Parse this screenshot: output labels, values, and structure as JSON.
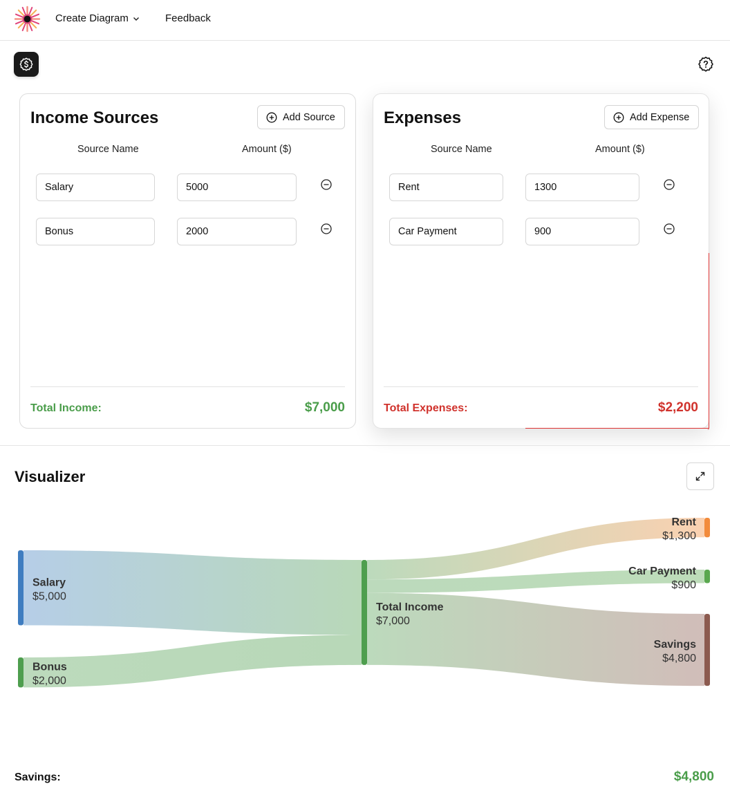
{
  "nav": {
    "create_label": "Create Diagram",
    "feedback_label": "Feedback"
  },
  "income": {
    "title": "Income Sources",
    "add_label": "Add Source",
    "col_name": "Source Name",
    "col_amount": "Amount ($)",
    "rows": [
      {
        "name": "Salary",
        "amount": "5000"
      },
      {
        "name": "Bonus",
        "amount": "2000"
      }
    ],
    "total_label": "Total Income:",
    "total_value": "$7,000"
  },
  "expenses": {
    "title": "Expenses",
    "add_label": "Add Expense",
    "col_name": "Source Name",
    "col_amount": "Amount ($)",
    "rows": [
      {
        "name": "Rent",
        "amount": "1300"
      },
      {
        "name": "Car Payment",
        "amount": "900"
      }
    ],
    "total_label": "Total Expenses:",
    "total_value": "$2,200"
  },
  "visualizer": {
    "title": "Visualizer"
  },
  "chart_data": {
    "type": "sankey",
    "nodes": [
      {
        "id": "salary",
        "name": "Salary",
        "value_label": "$5,000",
        "value": 5000,
        "color": "#3f7dc0"
      },
      {
        "id": "bonus",
        "name": "Bonus",
        "value_label": "$2,000",
        "value": 2000,
        "color": "#4e9e4e"
      },
      {
        "id": "total",
        "name": "Total Income",
        "value_label": "$7,000",
        "value": 7000,
        "color": "#4e9e4e"
      },
      {
        "id": "rent",
        "name": "Rent",
        "value_label": "$1,300",
        "value": 1300,
        "color": "#f28b3c"
      },
      {
        "id": "car",
        "name": "Car Payment",
        "value_label": "$900",
        "value": 900,
        "color": "#5aa84f"
      },
      {
        "id": "savings",
        "name": "Savings",
        "value_label": "$4,800",
        "value": 4800,
        "color": "#8c5a4f"
      }
    ],
    "links": [
      {
        "source": "salary",
        "target": "total",
        "value": 5000
      },
      {
        "source": "bonus",
        "target": "total",
        "value": 2000
      },
      {
        "source": "total",
        "target": "rent",
        "value": 1300
      },
      {
        "source": "total",
        "target": "car",
        "value": 900
      },
      {
        "source": "total",
        "target": "savings",
        "value": 4800
      }
    ]
  },
  "savings": {
    "label": "Savings:",
    "value": "$4,800"
  },
  "colors": {
    "income_green": "#4a9d4a",
    "expense_red": "#d0322c"
  }
}
